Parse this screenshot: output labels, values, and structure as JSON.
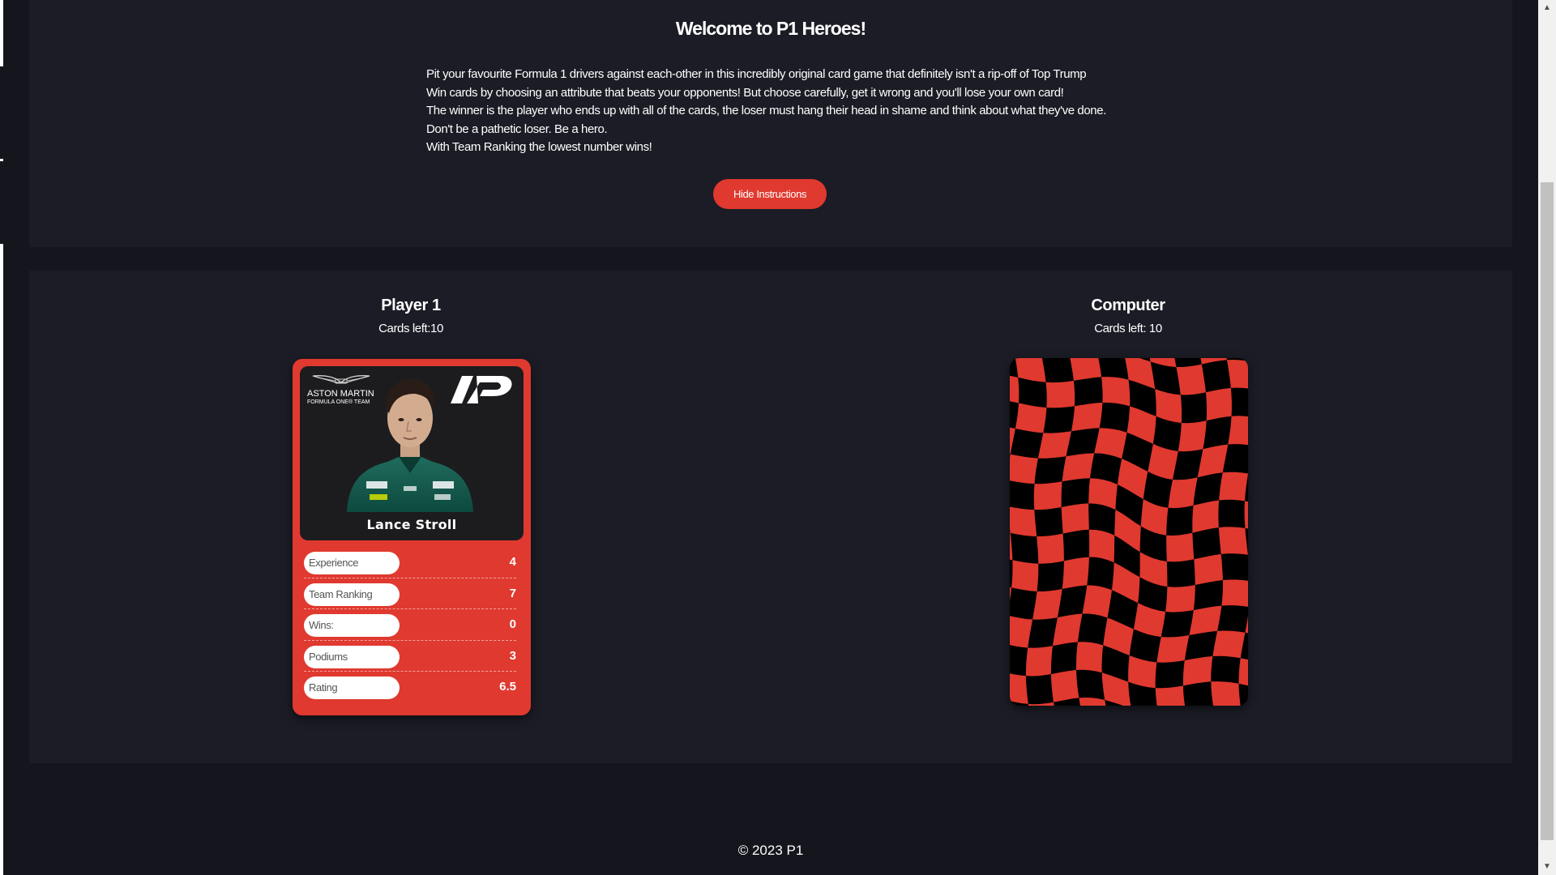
{
  "instructions": {
    "title": "Welcome to P1 Heroes!",
    "lines": [
      "Pit your favourite Formula 1 drivers against each-other in this incredibly original card game that definitely isn't a rip-off of Top Trump",
      "Win cards by choosing an attribute that beats your opponents! But choose carefully, get it wrong and you'll lose your own card!",
      "The winner is the player who ends up with all of the cards, the loser must hang their head in shame and think about what they've done.",
      "Don't be a pathetic loser. Be a hero.",
      "With Team Ranking the lowest number wins!"
    ],
    "hide_button_label": "Hide Instructions"
  },
  "player1": {
    "name": "Player 1",
    "cards_left": "Cards left:10",
    "card": {
      "team_line1": "ASTON MARTIN",
      "team_line2": "FORMULA ONE® TEAM",
      "driver_name": "Lance Stroll",
      "stats": [
        {
          "label": "Experience",
          "value": "4"
        },
        {
          "label": "Team Ranking",
          "value": "7"
        },
        {
          "label": "Wins:",
          "value": "0"
        },
        {
          "label": "Podiums",
          "value": "3"
        },
        {
          "label": "Rating",
          "value": "6.5"
        }
      ]
    }
  },
  "computer": {
    "name": "Computer",
    "cards_left": "Cards left: 10"
  },
  "footer": {
    "text": "© 2023 P1"
  },
  "colors": {
    "accent": "#e0392f",
    "background": "#15161d",
    "panel": "#1b1c25"
  }
}
